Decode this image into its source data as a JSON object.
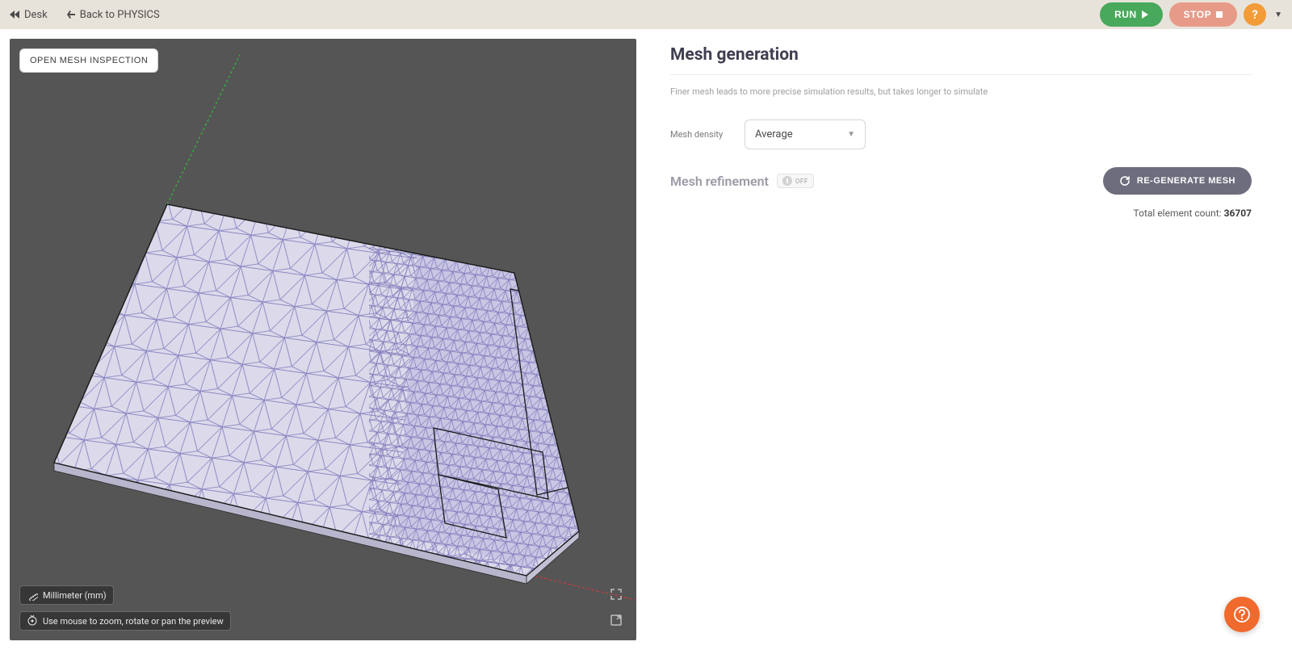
{
  "topbar": {
    "desk_label": "Desk",
    "back_label": "Back to PHYSICS",
    "run_label": "RUN",
    "stop_label": "STOP",
    "help_glyph": "?"
  },
  "viewport": {
    "open_inspection_label": "OPEN MESH INSPECTION",
    "units_label": "Millimeter (mm)",
    "hint_label": "Use mouse to zoom, rotate or pan the preview"
  },
  "panel": {
    "title": "Mesh generation",
    "description": "Finer mesh leads to more precise simulation results, but takes longer to simulate",
    "density_label": "Mesh density",
    "density_value": "Average",
    "refinement_label": "Mesh refinement",
    "refinement_toggle": "OFF",
    "regenerate_label": "RE-GENERATE MESH",
    "count_label": "Total element count: ",
    "count_value": "36707"
  },
  "icons": {
    "back_double": "rewind-icon",
    "back_single": "back-arrow-icon",
    "play": "play-icon",
    "stop": "stop-icon",
    "ruler": "ruler-icon",
    "mouse": "cursor-icon",
    "expand": "expand-icon",
    "fullscreen": "fullscreen-icon",
    "refresh": "refresh-icon",
    "chevron_down": "chevron-down-icon",
    "help": "help-icon"
  }
}
